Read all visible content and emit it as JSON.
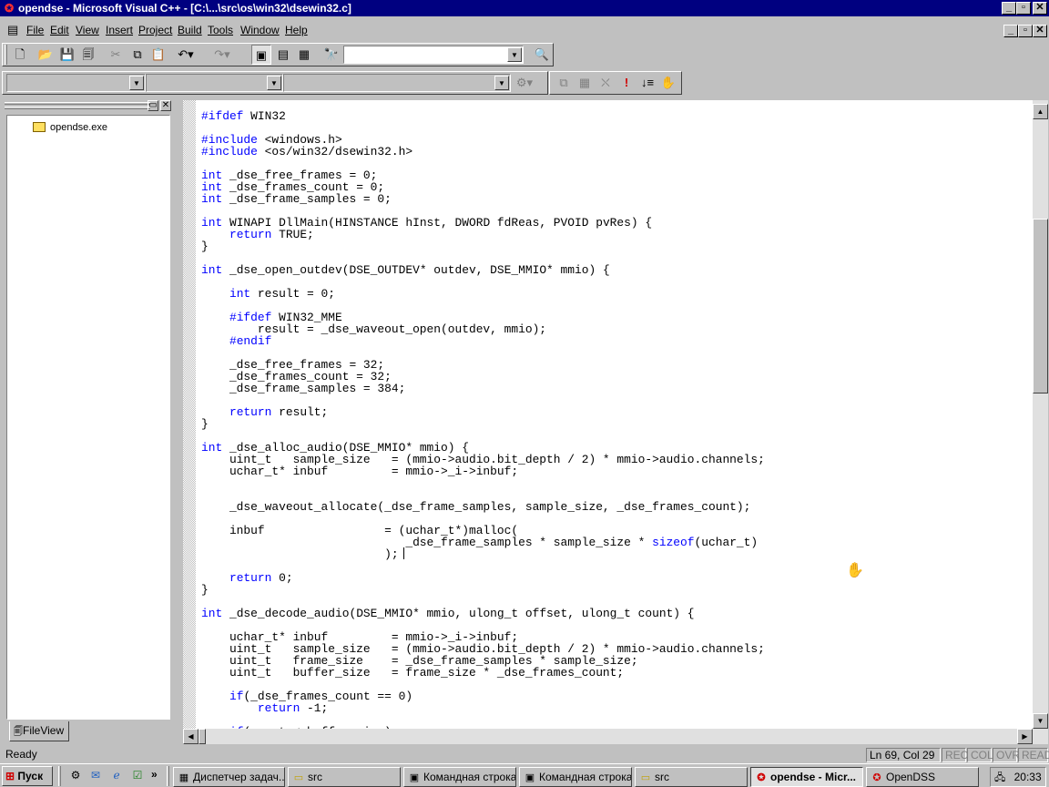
{
  "window": {
    "title": "opendse - Microsoft Visual C++ - [C:\\...\\src\\os\\win32\\dsewin32.c]"
  },
  "menu": [
    "File",
    "Edit",
    "View",
    "Insert",
    "Project",
    "Build",
    "Tools",
    "Window",
    "Help"
  ],
  "workspace": {
    "root_item": "opendse.exe",
    "tab_label": "FileView"
  },
  "code_lines": [
    "#ifdef WIN32",
    "",
    "#include <windows.h>",
    "#include <os/win32/dsewin32.h>",
    "",
    "int _dse_free_frames = 0;",
    "int _dse_frames_count = 0;",
    "int _dse_frame_samples = 0;",
    "",
    "int WINAPI DllMain(HINSTANCE hInst, DWORD fdReas, PVOID pvRes) {",
    "    return TRUE;",
    "}",
    "",
    "int _dse_open_outdev(DSE_OUTDEV* outdev, DSE_MMIO* mmio) {",
    "",
    "    int result = 0;",
    "",
    "    #ifdef WIN32_MME",
    "        result = _dse_waveout_open(outdev, mmio);",
    "    #endif",
    "",
    "    _dse_free_frames = 32;",
    "    _dse_frames_count = 32;",
    "    _dse_frame_samples = 384;",
    "",
    "    return result;",
    "}",
    "",
    "int _dse_alloc_audio(DSE_MMIO* mmio) {",
    "    uint_t   sample_size   = (mmio->audio.bit_depth / 2) * mmio->audio.channels;",
    "    uchar_t* inbuf         = mmio->_i->inbuf;",
    "",
    "",
    "    _dse_waveout_allocate(_dse_frame_samples, sample_size, _dse_frames_count);",
    "",
    "    inbuf                 = (uchar_t*)malloc(",
    "                             _dse_frame_samples * sample_size * sizeof(uchar_t)",
    "                          );",
    "",
    "    return 0;",
    "}",
    "",
    "int _dse_decode_audio(DSE_MMIO* mmio, ulong_t offset, ulong_t count) {",
    "",
    "    uchar_t* inbuf         = mmio->_i->inbuf;",
    "    uint_t   sample_size   = (mmio->audio.bit_depth / 2) * mmio->audio.channels;",
    "    uint_t   frame_size    = _dse_frame_samples * sample_size;",
    "    uint_t   buffer_size   = frame_size * _dse_frames_count;",
    "",
    "    if(_dse_frames_count == 0)",
    "        return -1;",
    "",
    "    if(count < buffer_size)"
  ],
  "keywords": [
    "#ifdef",
    "#include",
    "#endif",
    "int",
    "return",
    "sizeof",
    "if"
  ],
  "status": {
    "text": "Ready",
    "position": "Ln 69, Col 29",
    "indicators": [
      "REC",
      "COL",
      "OVR",
      "READ"
    ]
  },
  "taskbar": {
    "start_label": "Пуск",
    "quicklaunch_more": "»",
    "tasks": [
      "Диспетчер задач...",
      "src",
      "Командная строка",
      "Командная строка",
      "src",
      "opendse - Micr...",
      "OpenDSS"
    ],
    "active_index": 5,
    "clock": "20:33"
  },
  "colors": {
    "title_bar": "#000080",
    "keyword": "#0000ff",
    "face": "#c0c0c0"
  }
}
